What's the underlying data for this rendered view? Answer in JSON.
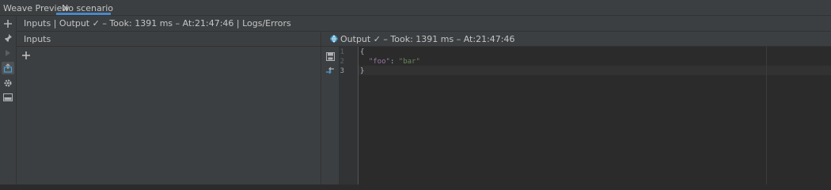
{
  "tabs": {
    "title": "Weave Preview",
    "scenario": "No scenario"
  },
  "status": {
    "text": "Inputs | Output ✓ – Took: 1391 ms – At:21:47:46 | Logs/Errors"
  },
  "inputs": {
    "title": "Inputs"
  },
  "output": {
    "title": "Output ✓ – Took: 1391 ms – At:21:47:46",
    "lines": [
      "1",
      "2",
      "3"
    ],
    "code": {
      "open": "{",
      "key": "\"foo\"",
      "sep": ": ",
      "value": "\"bar\"",
      "close": "}"
    }
  },
  "colors": {
    "accent": "#4a88c7",
    "panel": "#3c3f41",
    "editor": "#2b2b2b"
  }
}
